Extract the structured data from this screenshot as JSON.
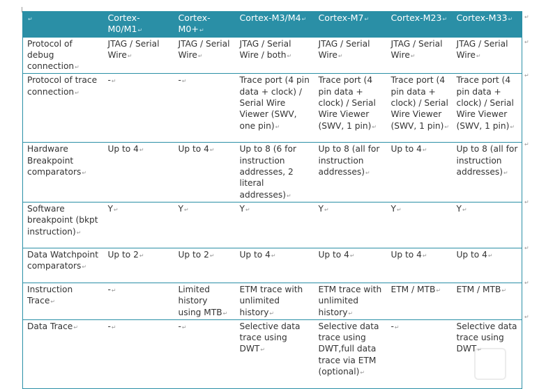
{
  "table": {
    "headers": [
      "",
      "Cortex-M0/M1",
      "Cortex-M0+",
      "Cortex-M3/M4",
      "Cortex-M7",
      "Cortex-M23",
      "Cortex-M33"
    ],
    "rows": [
      {
        "label": "Protocol of debug connection",
        "cells": [
          "JTAG / Serial Wire",
          "JTAG / Serial Wire",
          "JTAG / Serial Wire / both",
          "JTAG / Serial Wire",
          "JTAG / Serial Wire",
          "JTAG / Serial Wire"
        ]
      },
      {
        "label": "Protocol of trace connection",
        "cells": [
          "-",
          "-",
          "Trace port (4 pin data + clock) / Serial Wire Viewer (SWV, one pin)",
          "Trace port (4 pin data + clock) / Serial Wire Viewer (SWV, 1 pin)",
          "Trace port (4 pin data + clock) / Serial Wire Viewer (SWV, 1 pin)",
          "Trace port (4 pin data + clock) / Serial Wire Viewer (SWV, 1 pin)"
        ]
      },
      {
        "label": "Hardware Breakpoint comparators",
        "cells": [
          "Up to 4",
          "Up to 4",
          "Up to 8 (6 for instruction addresses, 2 literal addresses)",
          "Up to 8 (all for instruction addresses)",
          "Up to 4",
          "Up to 8 (all for instruction addresses)"
        ]
      },
      {
        "label": "Software breakpoint (bkpt instruction)",
        "cells": [
          "Y",
          "Y",
          "Y",
          "Y",
          "Y",
          "Y"
        ]
      },
      {
        "label": "Data Watchpoint comparators",
        "cells": [
          "Up to 2",
          "Up to 2",
          "Up to 4",
          "Up to 4",
          "Up to 4",
          "Up to 4"
        ]
      },
      {
        "label": "Instruction Trace",
        "cells": [
          "-",
          "Limited history using MTB",
          "ETM trace with unlimited history",
          "ETM trace with unlimited history",
          "ETM / MTB",
          "ETM / MTB"
        ]
      },
      {
        "label": "Data Trace",
        "cells": [
          "-",
          "-",
          "Selective data trace using DWT",
          "Selective data trace using DWT,full data trace via ETM (optional)",
          "-",
          "Selective data trace using DWT"
        ]
      }
    ]
  },
  "colors": {
    "header_bg": "#2a8fa6",
    "border": "#2a8fa6"
  }
}
